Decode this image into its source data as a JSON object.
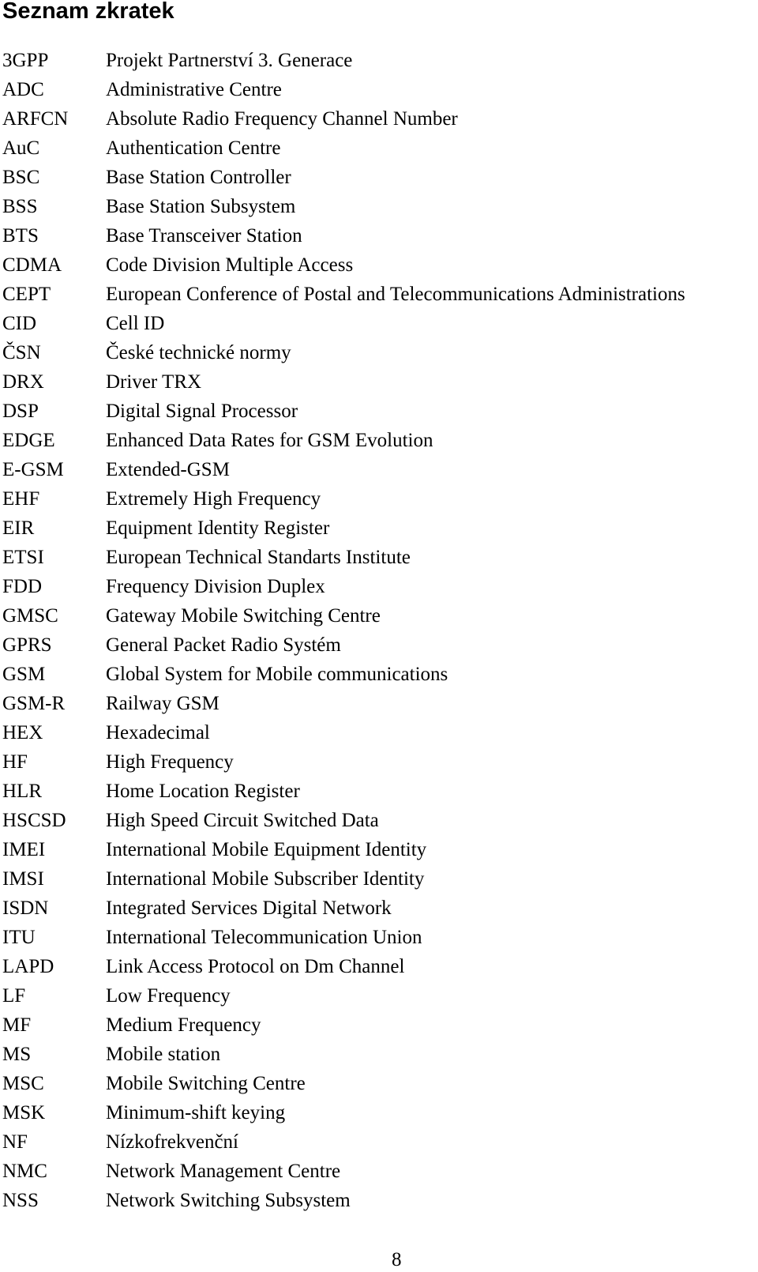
{
  "title": "Seznam zkratek",
  "abbreviations": [
    {
      "abbr": "3GPP",
      "desc": "Projekt Partnerství 3. Generace"
    },
    {
      "abbr": "ADC",
      "desc": "Administrative Centre"
    },
    {
      "abbr": "ARFCN",
      "desc": "Absolute Radio Frequency Channel Number"
    },
    {
      "abbr": "AuC",
      "desc": "Authentication Centre"
    },
    {
      "abbr": "BSC",
      "desc": "Base Station Controller"
    },
    {
      "abbr": "BSS",
      "desc": "Base Station Subsystem"
    },
    {
      "abbr": "BTS",
      "desc": "Base Transceiver Station"
    },
    {
      "abbr": "CDMA",
      "desc": "Code Division Multiple Access"
    },
    {
      "abbr": "CEPT",
      "desc": "European Conference of Postal and Telecommunications Administrations"
    },
    {
      "abbr": "CID",
      "desc": "Cell ID"
    },
    {
      "abbr": "ČSN",
      "desc": "České technické normy"
    },
    {
      "abbr": "DRX",
      "desc": "Driver TRX"
    },
    {
      "abbr": "DSP",
      "desc": "Digital Signal Processor"
    },
    {
      "abbr": "EDGE",
      "desc": "Enhanced Data Rates for GSM Evolution"
    },
    {
      "abbr": "E-GSM",
      "desc": "Extended-GSM"
    },
    {
      "abbr": "EHF",
      "desc": "Extremely High Frequency"
    },
    {
      "abbr": "EIR",
      "desc": "Equipment Identity Register"
    },
    {
      "abbr": "ETSI",
      "desc": "European Technical Standarts Institute"
    },
    {
      "abbr": "FDD",
      "desc": "Frequency Division Duplex"
    },
    {
      "abbr": "GMSC",
      "desc": "Gateway Mobile Switching Centre"
    },
    {
      "abbr": "GPRS",
      "desc": "General Packet Radio Systém"
    },
    {
      "abbr": "GSM",
      "desc": "Global System for Mobile communications"
    },
    {
      "abbr": "GSM-R",
      "desc": "Railway GSM"
    },
    {
      "abbr": "HEX",
      "desc": "Hexadecimal"
    },
    {
      "abbr": "HF",
      "desc": "High Frequency"
    },
    {
      "abbr": "HLR",
      "desc": "Home Location Register"
    },
    {
      "abbr": "HSCSD",
      "desc": "High Speed Circuit Switched Data"
    },
    {
      "abbr": "IMEI",
      "desc": "International Mobile Equipment Identity"
    },
    {
      "abbr": "IMSI",
      "desc": "International Mobile Subscriber Identity"
    },
    {
      "abbr": "ISDN",
      "desc": "Integrated Services Digital Network"
    },
    {
      "abbr": "ITU",
      "desc": "International Telecommunication Union"
    },
    {
      "abbr": "LAPD",
      "desc": "Link Access Protocol on Dm Channel"
    },
    {
      "abbr": "LF",
      "desc": "Low Frequency"
    },
    {
      "abbr": "MF",
      "desc": "Medium Frequency"
    },
    {
      "abbr": "MS",
      "desc": "Mobile station"
    },
    {
      "abbr": "MSC",
      "desc": "Mobile Switching Centre"
    },
    {
      "abbr": "MSK",
      "desc": "Minimum-shift keying"
    },
    {
      "abbr": "NF",
      "desc": "Nízkofrekvenční"
    },
    {
      "abbr": "NMC",
      "desc": "Network Management Centre"
    },
    {
      "abbr": "NSS",
      "desc": "Network Switching Subsystem"
    }
  ],
  "page_number": "8"
}
